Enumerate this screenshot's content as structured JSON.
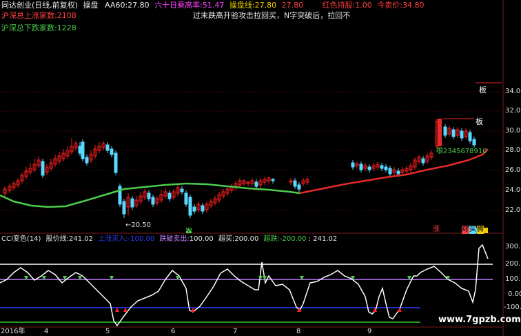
{
  "colors": {
    "bg": "#000000",
    "up": "#ff2020",
    "down": "#5ad8ff",
    "ma_green": "#4ccc4c",
    "ma_red": "#e42a2a",
    "cci": "#ffffff",
    "line_top": "#ffffff",
    "line_upper": "#c080ff",
    "line_lower": "#2b3cff",
    "line_bottom": "#2fd22f",
    "grid": "#6a0e0e",
    "yellow": "#f0d000",
    "magenta": "#ff40ff"
  },
  "header": {
    "title": "同达创业(日线,前复权)",
    "mode": "操盘",
    "aa60_label": "AA60:",
    "aa60_value": "27.80",
    "line60_label": "六十日乘高率:",
    "line60_value": "51.47",
    "cao_label": "操盘线:",
    "cao_value": "27.80",
    "cao_extra": "27.80",
    "red_label": "红色持股:",
    "red_value": "1.00",
    "buy_label": "今卖价:",
    "buy_value": "34.80",
    "note": "过末跌高开验攻击拉回买，N字突破后，拉回不",
    "up_count_label": "沪深总上涨家数:",
    "up_count_value": "2108",
    "down_count_label": "沪深总下跌家数:",
    "down_count_value": "1228"
  },
  "price_axis": {
    "ticks": [
      "34.00",
      "32.00",
      "30.00",
      "28.00",
      "26.00",
      "24.00",
      "22.00"
    ]
  },
  "annotations": {
    "low_mark": "←20.50",
    "board1": "板",
    "board2": "板",
    "gen_count": "根2345678910",
    "die": "跌",
    "zhang": "涨",
    "cai": "财",
    "mai": "买",
    "teng": "腾"
  },
  "indicator": {
    "name": "CCI变色(14)",
    "stock_line_label": "股价线:",
    "stock_line_value": "241.02",
    "up_buy_label": "上涨买入:",
    "up_buy_value": "-100.00",
    "down_sell_label": "跌破卖出:",
    "down_sell_value": "100.00",
    "over_buy_label": "超买:",
    "over_buy_value": "200.00",
    "over_sell_label": "超跌:",
    "over_sell_value": "-200.00",
    "current_value": ": 241.02",
    "ticks": [
      "300.0",
      "200.0",
      "100.0",
      "0.00",
      "-100.0"
    ]
  },
  "date_axis": {
    "labels": [
      "2016年",
      "4",
      "5",
      "6",
      "7",
      "8",
      "9"
    ]
  },
  "watermark": "www.7gpzb.com"
}
